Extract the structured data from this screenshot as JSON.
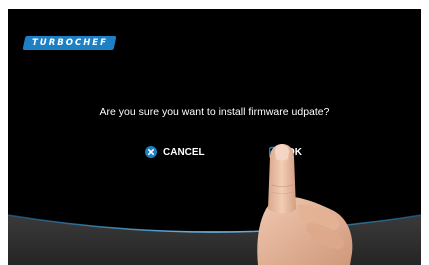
{
  "brand": {
    "logo_text": "TURBOCHEF"
  },
  "dialog": {
    "message": "Are you sure you want to install firmware udpate?",
    "cancel_label": "CANCEL",
    "ok_label": "OK"
  },
  "colors": {
    "background": "#000000",
    "accent": "#1d7fc4",
    "bottom_panel": "#2e2e2e",
    "arc_glow": "#3aa0d8"
  },
  "icons": {
    "cancel": "close-circle-icon",
    "ok": "checkbox-checked-icon"
  }
}
